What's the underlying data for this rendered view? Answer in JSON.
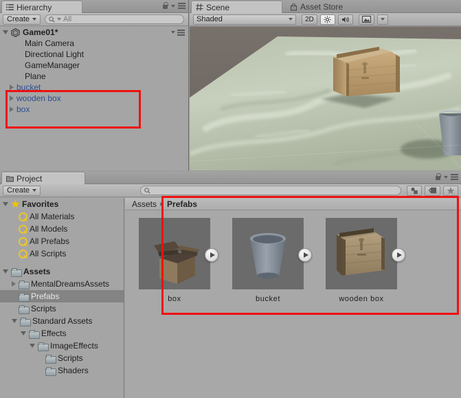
{
  "hierarchy": {
    "tab_label": "Hierarchy",
    "tab_icon": "hierarchy-icon",
    "create_label": "Create",
    "search_placeholder": "All",
    "search_value": "",
    "scene_name": "Game01*",
    "items": [
      {
        "label": "Main Camera",
        "type": "object",
        "indent": 2
      },
      {
        "label": "Directional Light",
        "type": "object",
        "indent": 2
      },
      {
        "label": "GameManager",
        "type": "object",
        "indent": 2
      },
      {
        "label": "Plane",
        "type": "object",
        "indent": 2
      },
      {
        "label": "bucket",
        "type": "prefab",
        "indent": 1
      },
      {
        "label": "wooden box",
        "type": "prefab",
        "indent": 1
      },
      {
        "label": "box",
        "type": "prefab",
        "indent": 1
      }
    ]
  },
  "scene": {
    "tab_label": "Scene",
    "tab_icon": "grid-icon",
    "asset_store_tab": "Asset Store",
    "asset_store_icon": "shopping-bag-icon",
    "draw_mode": "Shaded",
    "mode_2d": "2D",
    "lighting_icon": "sun-icon",
    "audio_icon": "speaker-icon",
    "gizmos_icon": "image-icon",
    "objects": [
      {
        "name": "wooden box",
        "kind": "crate"
      },
      {
        "name": "bucket",
        "kind": "bucket"
      }
    ]
  },
  "project": {
    "tab_label": "Project",
    "tab_icon": "folder-icon",
    "create_label": "Create",
    "search_placeholder": "",
    "search_value": "",
    "filter_icons": [
      "object-filter-icon",
      "label-filter-icon",
      "favorite-filter-icon"
    ],
    "lock_icon": "lock-icon",
    "menu_icon": "hamburger-menu-icon",
    "tree": [
      {
        "label": "Favorites",
        "icon": "star-icon",
        "indent": 1,
        "arrow": "down",
        "bold": true,
        "selected": false
      },
      {
        "label": "All Materials",
        "icon": "magnifier-icon",
        "indent": 2,
        "arrow": "",
        "bold": false,
        "selected": false
      },
      {
        "label": "All Models",
        "icon": "magnifier-icon",
        "indent": 2,
        "arrow": "",
        "bold": false,
        "selected": false
      },
      {
        "label": "All Prefabs",
        "icon": "magnifier-icon",
        "indent": 2,
        "arrow": "",
        "bold": false,
        "selected": false
      },
      {
        "label": "All Scripts",
        "icon": "magnifier-icon",
        "indent": 2,
        "arrow": "",
        "bold": false,
        "selected": false
      },
      {
        "label": "",
        "icon": "",
        "indent": 1,
        "arrow": "",
        "bold": false,
        "selected": false
      },
      {
        "label": "Assets",
        "icon": "folder-icon",
        "indent": 1,
        "arrow": "down",
        "bold": true,
        "selected": false
      },
      {
        "label": "MentalDreamsAssets",
        "icon": "folder-icon",
        "indent": 2,
        "arrow": "right",
        "bold": false,
        "selected": false
      },
      {
        "label": "Prefabs",
        "icon": "folder-icon",
        "indent": 2,
        "arrow": "",
        "bold": false,
        "selected": true
      },
      {
        "label": "Scripts",
        "icon": "folder-icon",
        "indent": 2,
        "arrow": "",
        "bold": false,
        "selected": false
      },
      {
        "label": "Standard Assets",
        "icon": "folder-icon",
        "indent": 2,
        "arrow": "down",
        "bold": false,
        "selected": false
      },
      {
        "label": "Effects",
        "icon": "folder-icon",
        "indent": 3,
        "arrow": "down",
        "bold": false,
        "selected": false
      },
      {
        "label": "ImageEffects",
        "icon": "folder-icon",
        "indent": 4,
        "arrow": "down",
        "bold": false,
        "selected": false
      },
      {
        "label": "Scripts",
        "icon": "folder-icon",
        "indent": 5,
        "arrow": "",
        "bold": false,
        "selected": false
      },
      {
        "label": "Shaders",
        "icon": "folder-icon",
        "indent": 5,
        "arrow": "",
        "bold": false,
        "selected": false
      }
    ],
    "breadcrumb": {
      "root": "Assets",
      "current": "Prefabs"
    },
    "assets": [
      {
        "name": "box",
        "kind": "open-box",
        "badge": "prefab-play-badge"
      },
      {
        "name": "bucket",
        "kind": "bucket",
        "badge": "prefab-play-badge"
      },
      {
        "name": "wooden box",
        "kind": "crate",
        "badge": "prefab-play-badge"
      }
    ]
  },
  "annotations": {
    "hierarchy_highlight": "red-rectangle-around-prefab-instances",
    "project_highlight": "red-rectangle-around-prefabs-folder-contents",
    "color": "#ee1111"
  }
}
